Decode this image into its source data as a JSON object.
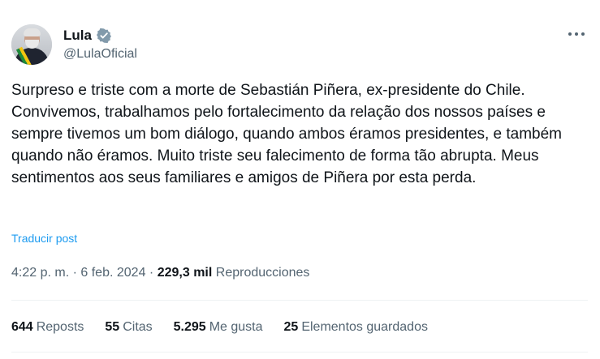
{
  "author": {
    "name": "Lula",
    "handle": "@LulaOficial",
    "verified_color": "#829aab"
  },
  "tweet": {
    "text": "Surpreso e triste com a morte de Sebastián Piñera, ex-presidente do Chile. Convivemos, trabalhamos pelo fortalecimento da relação dos nossos países e sempre tivemos um bom diálogo, quando ambos éramos presidentes, e também quando não éramos. Muito triste seu falecimento de forma tão abrupta. Meus sentimentos aos seus familiares e amigos de Piñera por esta perda.",
    "translate_label": "Traducir post",
    "time": "4:22 p. m.",
    "separator": "·",
    "date": "6 feb. 2024",
    "views_count": "229,3 mil",
    "views_label": "Reproducciones"
  },
  "stats": [
    {
      "count": "644",
      "label": "Reposts"
    },
    {
      "count": "55",
      "label": "Citas"
    },
    {
      "count": "5.295",
      "label": "Me gusta"
    },
    {
      "count": "25",
      "label": "Elementos guardados"
    }
  ],
  "colors": {
    "link": "#1d9bf0",
    "secondary_text": "#536471",
    "primary_text": "#0f1419",
    "divider": "#eff3f4"
  },
  "icons": {
    "verified": "verified-badge-icon",
    "more": "more-options-icon"
  }
}
